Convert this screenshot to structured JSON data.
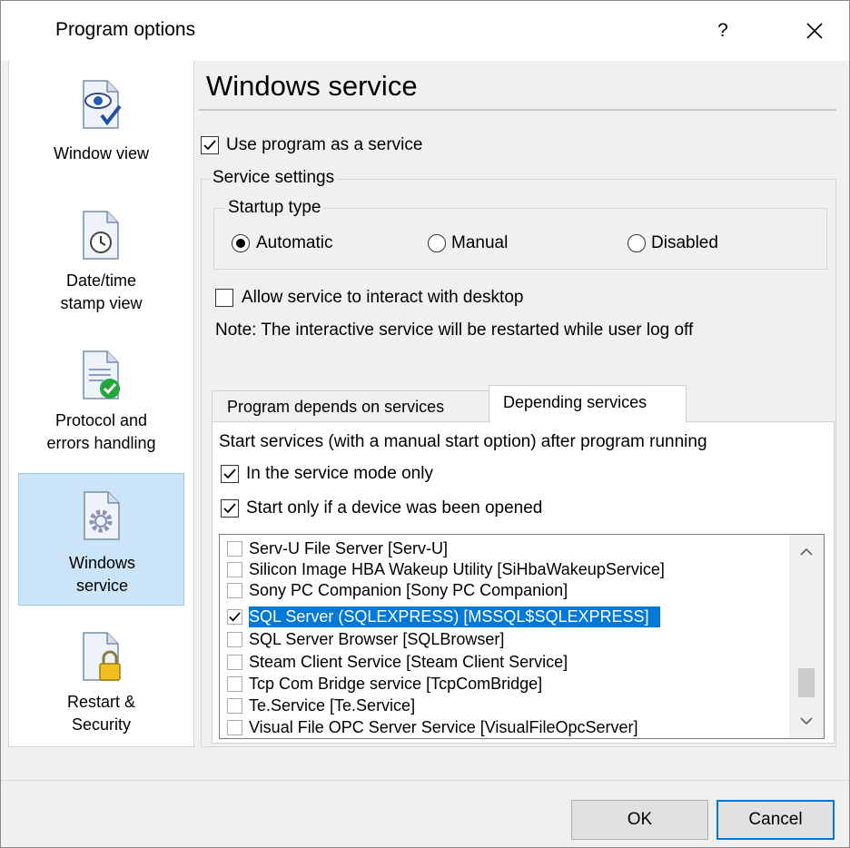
{
  "window": {
    "title": "Program options",
    "help_label": "?"
  },
  "sidebar": {
    "items": [
      {
        "label_line1": "Window view",
        "label_line2": "",
        "icon": "eye-check-icon"
      },
      {
        "label_line1": "Date/time",
        "label_line2": "stamp view",
        "icon": "clock-icon"
      },
      {
        "label_line1": "Protocol and",
        "label_line2": "errors handling",
        "icon": "check-badge-icon"
      },
      {
        "label_line1": "Windows",
        "label_line2": "service",
        "icon": "gear-icon",
        "selected": true
      },
      {
        "label_line1": "Restart &",
        "label_line2": "Security",
        "icon": "lock-icon"
      }
    ]
  },
  "main": {
    "title": "Windows service",
    "use_as_service": {
      "label": "Use program as a service",
      "checked": true
    },
    "service_settings": {
      "legend": "Service settings",
      "startup_type": {
        "legend": "Startup type",
        "options": [
          {
            "label": "Automatic",
            "selected": true
          },
          {
            "label": "Manual",
            "selected": false
          },
          {
            "label": "Disabled",
            "selected": false
          }
        ]
      },
      "interact_desktop": {
        "label": "Allow service to interact with desktop",
        "checked": false
      },
      "note": "Note: The interactive service will be restarted while user log off"
    },
    "tabs": [
      {
        "label": "Program depends on services",
        "active": false
      },
      {
        "label": "Depending services",
        "active": true
      }
    ],
    "depending": {
      "description": "Start services (with a manual start option) after program running",
      "service_mode_only": {
        "label": "In the service mode only",
        "checked": true
      },
      "device_opened": {
        "label": "Start only if a device was been opened",
        "checked": true
      },
      "services": [
        {
          "label": "Serv-U File Server [Serv-U]",
          "checked": false
        },
        {
          "label": "Silicon Image HBA Wakeup Utility [SiHbaWakeupService]",
          "checked": false
        },
        {
          "label": "Sony PC Companion [Sony PC Companion]",
          "checked": false
        },
        {
          "label": "SQL Server (SQLEXPRESS) [MSSQL$SQLEXPRESS]",
          "checked": true,
          "selected": true
        },
        {
          "label": "SQL Server Browser [SQLBrowser]",
          "checked": false
        },
        {
          "label": "Steam Client Service [Steam Client Service]",
          "checked": false
        },
        {
          "label": "Tcp Com Bridge service [TcpComBridge]",
          "checked": false
        },
        {
          "label": "Te.Service [Te.Service]",
          "checked": false
        },
        {
          "label": "Visual File OPC Server Service [VisualFileOpcServer]",
          "checked": false
        }
      ]
    }
  },
  "buttons": {
    "ok": "OK",
    "cancel": "Cancel"
  },
  "colors": {
    "selection": "#0078d7",
    "sidebar_selected": "#cce4f7"
  }
}
